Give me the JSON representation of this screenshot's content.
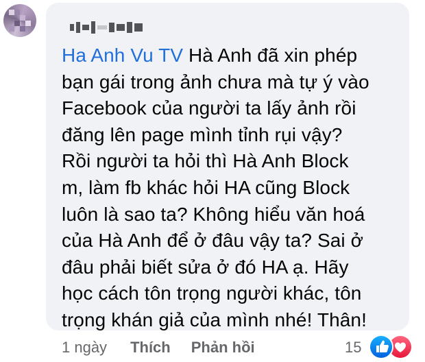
{
  "comment": {
    "author_name_obscured": true,
    "tag": "Ha Anh Vu TV",
    "text_lines": [
      " Hà Anh đã xin phép",
      "bạn gái trong ảnh chưa mà tự ý vào",
      "Facebook của người ta lấy ảnh rồi",
      "đăng lên page mình tỉnh rụi vậy?",
      "Rồi người ta hỏi thì Hà Anh Block",
      "m, làm fb khác hỏi HA cũng Block",
      "luôn là sao ta? Không hiểu văn hoá",
      "của Hà Anh để ở đâu vậy ta? Sai ở",
      "đâu phải biết sửa ở đó HA ạ. Hãy",
      "học cách tôn trọng người khác, tôn",
      "trọng khán giả của mình nhé! Thân!"
    ]
  },
  "actions": {
    "time": "1 ngày",
    "like": "Thích",
    "reply": "Phản hồi"
  },
  "reactions": {
    "count": "15",
    "types": [
      "like",
      "love"
    ],
    "colors": {
      "like": "#1877f2",
      "love": "#f33e58",
      "tag": "#216fdb"
    }
  },
  "icons": [
    "avatar",
    "like-reaction-icon",
    "love-reaction-icon"
  ]
}
